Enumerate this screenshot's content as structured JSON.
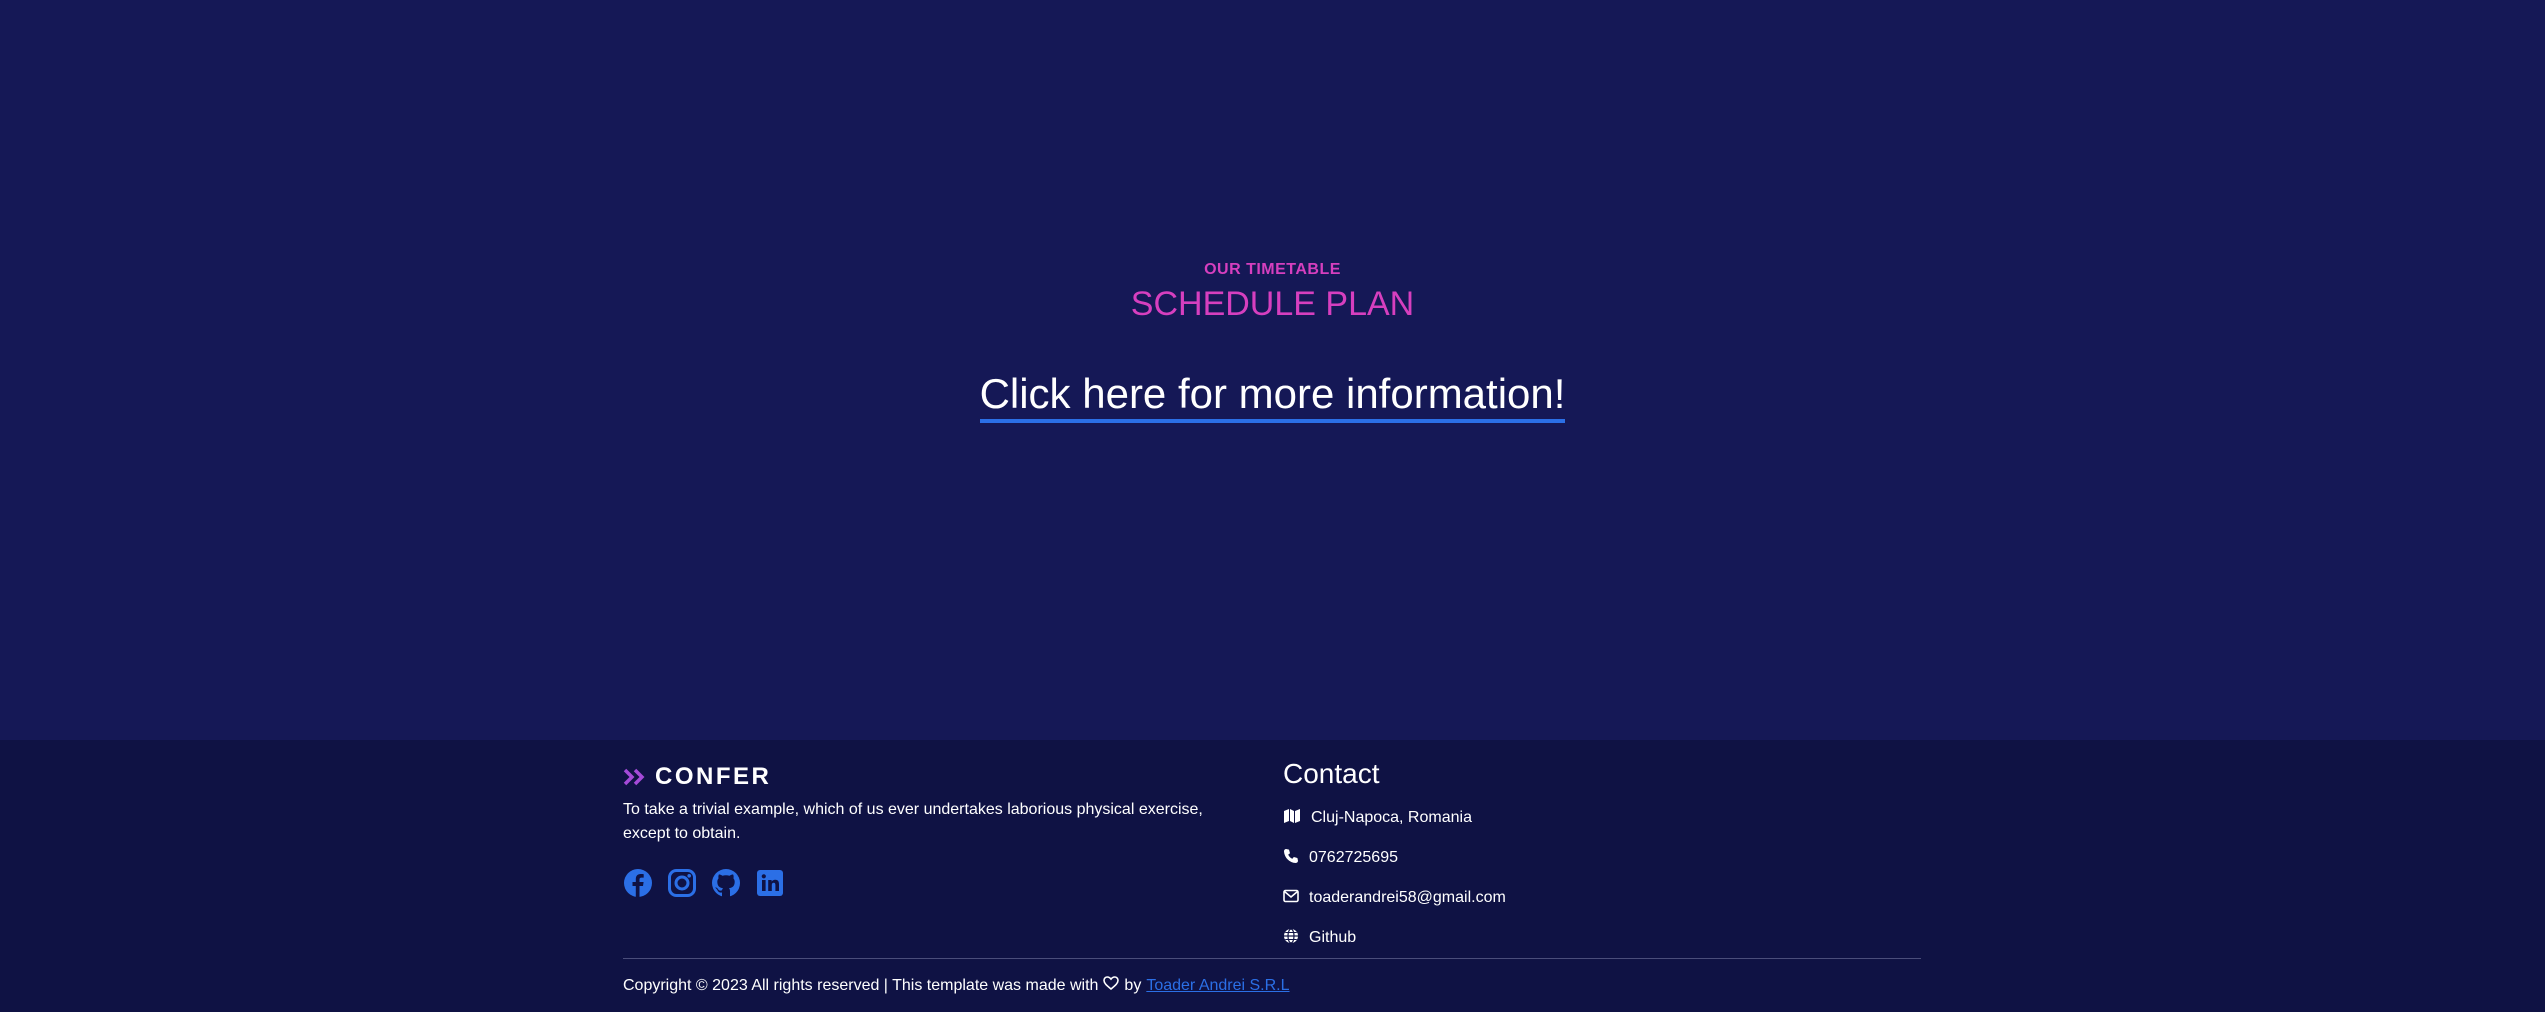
{
  "schedule": {
    "eyebrow": "OUR TIMETABLE",
    "headline": "SCHEDULE PLAN",
    "more_link": "Click here for more information!"
  },
  "footer": {
    "brand": {
      "name": "CONFER",
      "icon": "double-chevron-right-icon"
    },
    "about": "To take a trivial example, which of us ever undertakes laborious physical exercise, except to obtain.",
    "socials": [
      {
        "icon": "facebook-icon"
      },
      {
        "icon": "instagram-icon"
      },
      {
        "icon": "github-icon"
      },
      {
        "icon": "linkedin-icon"
      }
    ],
    "contact": {
      "title": "Contact",
      "items": [
        {
          "icon": "map-icon",
          "text": "Cluj-Napoca, Romania"
        },
        {
          "icon": "phone-icon",
          "text": "0762725695"
        },
        {
          "icon": "envelope-icon",
          "text": "toaderandrei58@gmail.com"
        },
        {
          "icon": "globe-icon",
          "text": "Github"
        }
      ]
    },
    "copyright": {
      "text_before": "Copyright © 2023 All rights reserved | This template was made with",
      "heart_icon": "heart-icon",
      "text_by": "by",
      "author_link": "Toader Andrei S.R.L"
    }
  },
  "colors": {
    "background": "#151856",
    "footer_background": "#0f1244",
    "accent_pink": "#d63fbf",
    "link_blue": "#2b6fe6"
  }
}
